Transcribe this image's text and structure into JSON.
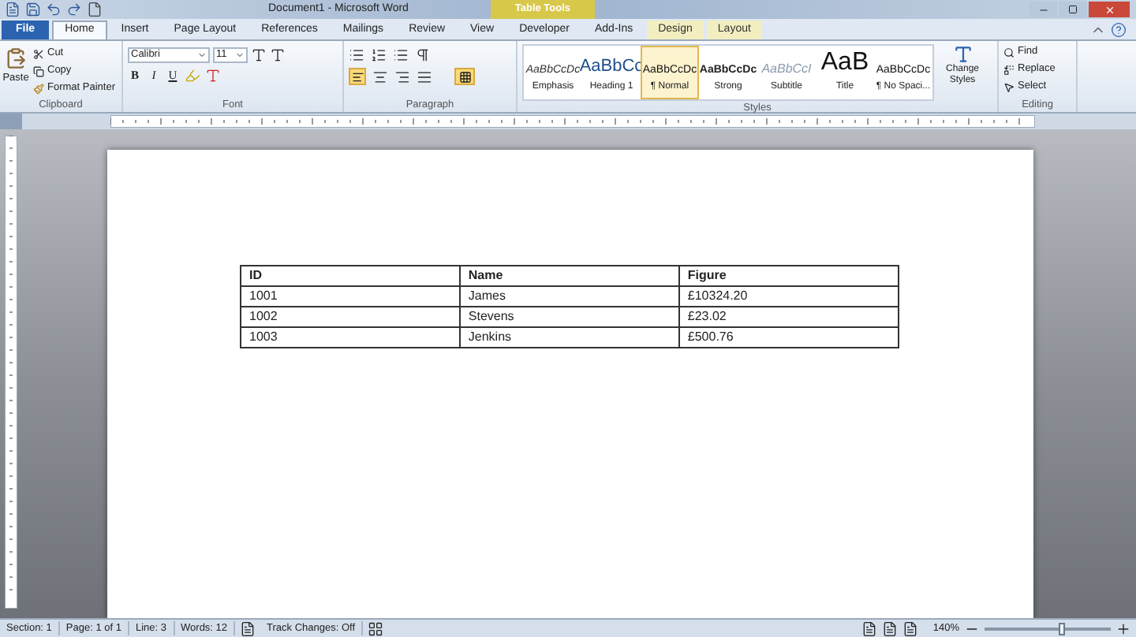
{
  "window": {
    "title": "Document1 - Microsoft Word",
    "context_tab_group": "Table Tools"
  },
  "tabs": [
    {
      "label": "File",
      "kind": "file",
      "selected": false
    },
    {
      "label": "Home",
      "kind": "tab",
      "selected": true
    },
    {
      "label": "Insert",
      "kind": "tab",
      "selected": false
    },
    {
      "label": "Page Layout",
      "kind": "tab",
      "selected": false
    },
    {
      "label": "References",
      "kind": "tab",
      "selected": false
    },
    {
      "label": "Mailings",
      "kind": "tab",
      "selected": false
    },
    {
      "label": "Review",
      "kind": "tab",
      "selected": false
    },
    {
      "label": "View",
      "kind": "tab",
      "selected": false
    },
    {
      "label": "Developer",
      "kind": "tab",
      "selected": false
    },
    {
      "label": "Add-Ins",
      "kind": "tab",
      "selected": false
    },
    {
      "label": "Design",
      "kind": "context",
      "selected": false
    },
    {
      "label": "Layout",
      "kind": "context",
      "selected": false
    }
  ],
  "clipboard": {
    "paste": "Paste",
    "items": [
      "Cut",
      "Copy",
      "Format Painter"
    ],
    "label": "Clipboard"
  },
  "font": {
    "name": "Calibri",
    "size": "11",
    "format_buttons": [
      "B",
      "I",
      "U"
    ],
    "label": "Font"
  },
  "paragraph": {
    "label": "Paragraph",
    "align_left_on": true,
    "borders_on": true
  },
  "styles": {
    "label": "Styles",
    "items": [
      {
        "preview": "AaBbCcDc",
        "name": "Emphasis",
        "kind": "italic",
        "selected": false
      },
      {
        "preview": "AaBbCc",
        "name": "Heading 1",
        "kind": "heading",
        "selected": false
      },
      {
        "preview": "AaBbCcDc",
        "name": "¶ Normal",
        "kind": "plain",
        "selected": true
      },
      {
        "preview": "AaBbCcDc",
        "name": "Strong",
        "kind": "bold",
        "selected": false
      },
      {
        "preview": "AaBbCcI",
        "name": "Subtitle",
        "kind": "subtitle",
        "selected": false
      },
      {
        "preview": "AaB",
        "name": "Title",
        "kind": "title",
        "selected": false
      },
      {
        "preview": "AaBbCcDc",
        "name": "¶ No Spaci...",
        "kind": "plain",
        "selected": false
      }
    ],
    "change_styles": "Change Styles"
  },
  "editing": {
    "label": "Editing",
    "items": [
      "Find",
      "Replace",
      "Select"
    ]
  },
  "table": {
    "columns": [
      "ID",
      "Name",
      "Figure"
    ],
    "rows": [
      [
        "1001",
        "James",
        "£10324.20"
      ],
      [
        "1002",
        "Stevens",
        "£23.02"
      ],
      [
        "1003",
        "Jenkins",
        "£500.76"
      ]
    ]
  },
  "status_bar": {
    "items": [
      "Section: 1",
      "Page: 1 of 1",
      "Line: 3",
      "Words: 12",
      "Track Changes: Off"
    ],
    "zoom": {
      "reading": "140%",
      "level": 0.62
    }
  }
}
